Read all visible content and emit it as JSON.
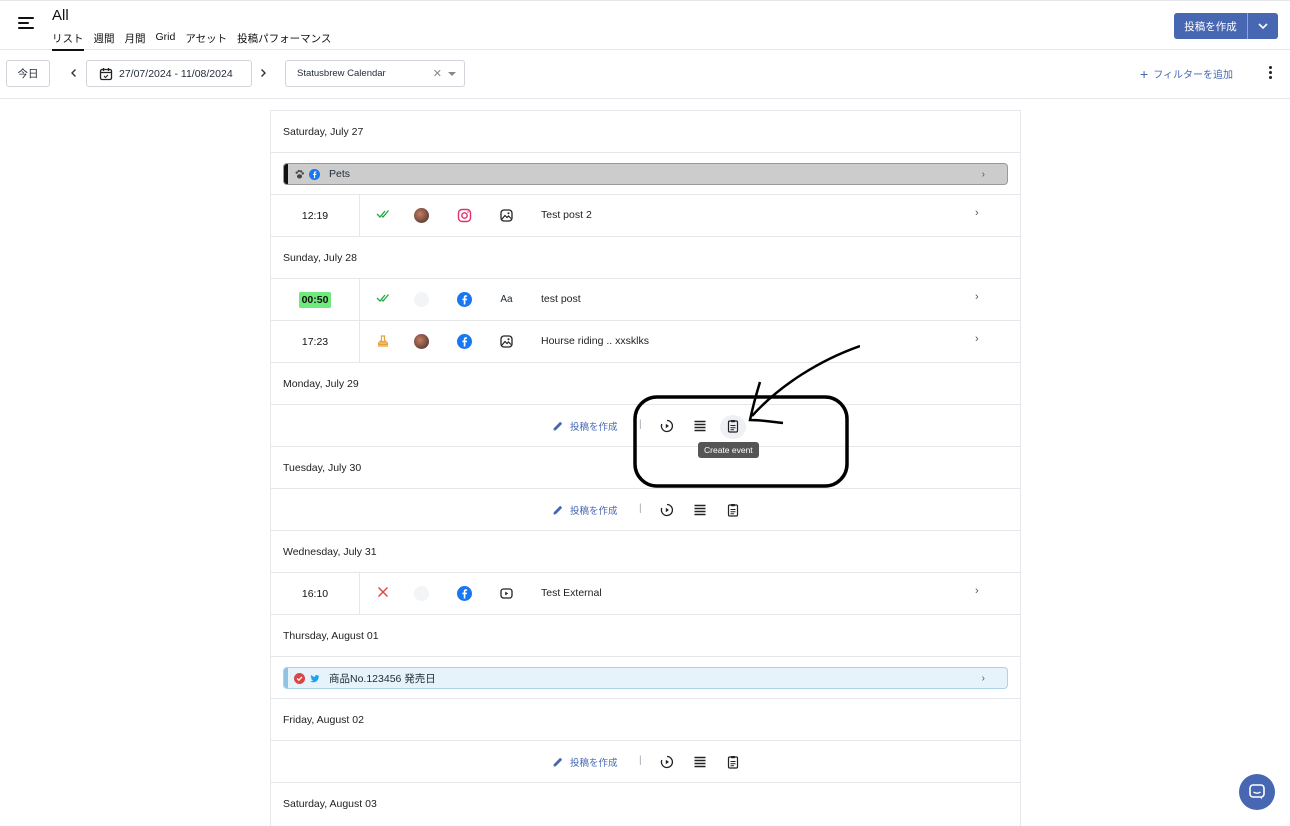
{
  "header": {
    "title": "All",
    "tabs": [
      "リスト",
      "週間",
      "月間",
      "Grid",
      "アセット",
      "投稿パフォーマンス"
    ],
    "create_label": "投稿を作成"
  },
  "toolbar": {
    "today_label": "今日",
    "date_range": "27/07/2024 - 11/08/2024",
    "calendar_value": "Statusbrew Calendar",
    "filter_label": "フィルターを追加"
  },
  "list": {
    "days": [
      "Saturday, July 27",
      "Sunday, July 28",
      "Monday, July 29",
      "Tuesday, July 30",
      "Wednesday, July 31",
      "Thursday, August 01",
      "Friday, August 02",
      "Saturday, August 03"
    ],
    "events": [
      {
        "title": "Pets",
        "color": "#cccccc",
        "stripe": "#111111"
      },
      {
        "title": "商品No.123456 発売日",
        "color": "#e6f3fb",
        "stripe": "#8fc3e6"
      }
    ],
    "posts": [
      {
        "time": "12:19",
        "title": "Test post 2",
        "network": "instagram",
        "status": "published"
      },
      {
        "time": "00:50",
        "title": "test post",
        "network": "facebook",
        "status": "published",
        "type_label": "Aa"
      },
      {
        "time": "17:23",
        "title": "Hourse riding .. xxsklks",
        "network": "facebook",
        "status": "approval"
      },
      {
        "time": "16:10",
        "title": "Test External",
        "network": "facebook",
        "status": "failed"
      }
    ],
    "compose_label": "投稿を作成",
    "separator": "|",
    "tooltip": "Create event"
  },
  "colors": {
    "accent": "#4767b2",
    "highlight_time": "#6ee97a",
    "published": "#22a745",
    "failed": "#e0463a",
    "approval": "#e8a23a"
  }
}
